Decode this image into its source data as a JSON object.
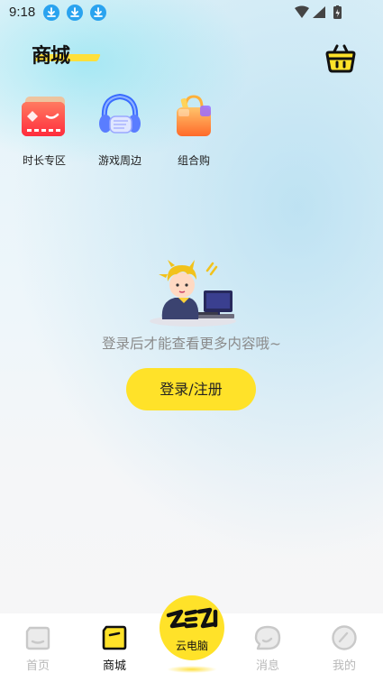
{
  "status_bar": {
    "time": "9:18"
  },
  "header": {
    "title": "商城"
  },
  "categories": [
    {
      "label": "时长专区",
      "icon": "time-card-icon"
    },
    {
      "label": "游戏周边",
      "icon": "game-merch-icon"
    },
    {
      "label": "组合购",
      "icon": "combo-bag-icon"
    }
  ],
  "empty_state": {
    "message": "登录后才能查看更多内容哦~",
    "button_label": "登录/注册"
  },
  "bottom_nav": {
    "items": [
      {
        "label": "首页",
        "icon": "home-icon"
      },
      {
        "label": "商城",
        "icon": "mall-icon"
      },
      {
        "label": "云电脑",
        "icon": "cloud-pc-icon"
      },
      {
        "label": "消息",
        "icon": "message-icon"
      },
      {
        "label": "我的",
        "icon": "profile-icon"
      }
    ],
    "active": "商城"
  },
  "colors": {
    "accent": "#ffe229",
    "download_badge": "#2aa3ef"
  }
}
